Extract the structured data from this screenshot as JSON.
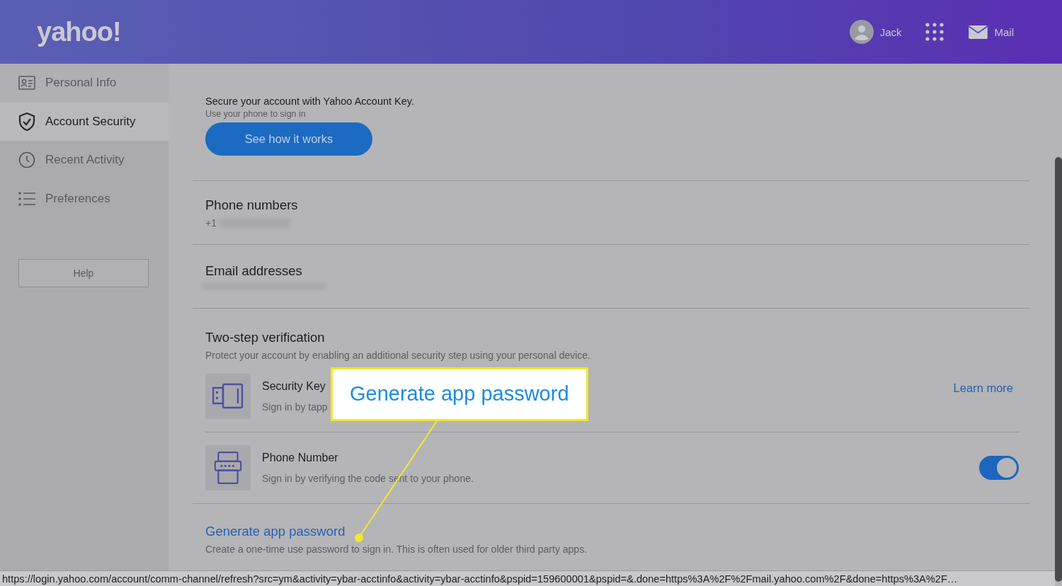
{
  "header": {
    "logo": "yahoo!",
    "user": "Jack",
    "mail": "Mail"
  },
  "sidebar": {
    "items": [
      {
        "label": "Personal Info",
        "selected": false
      },
      {
        "label": "Account Security",
        "selected": true
      },
      {
        "label": "Recent Activity",
        "selected": false
      },
      {
        "label": "Preferences",
        "selected": false
      }
    ],
    "help": "Help"
  },
  "account_key": {
    "title": "Secure your account with Yahoo Account Key.",
    "subtitle": "Use your phone to sign in",
    "button": "See how it works"
  },
  "phone_numbers": {
    "title": "Phone numbers",
    "value": "+1"
  },
  "email_addresses": {
    "title": "Email addresses"
  },
  "two_step": {
    "title": "Two-step verification",
    "description": "Protect your account by enabling an additional security step using your personal device.",
    "methods": [
      {
        "kind": "link",
        "title": "Security Key",
        "subtitle": "Sign in by tapp",
        "action": "Learn more"
      },
      {
        "kind": "toggle",
        "title": "Phone Number",
        "subtitle": "Sign in by verifying the code sent to your phone.",
        "on": true
      }
    ]
  },
  "app_password": {
    "link": "Generate app password",
    "description": "Create a one-time use password to sign in. This is often used for older third party apps."
  },
  "callout": {
    "text": "Generate app password"
  },
  "status_bar": {
    "url": "https://login.yahoo.com/account/comm-channel/refresh?src=ym&activity=ybar-acctinfo&activity=ybar-acctinfo&pspid=159600001&pspid=&.done=https%3A%2F%2Fmail.yahoo.com%2F&done=https%3A%2F…"
  }
}
